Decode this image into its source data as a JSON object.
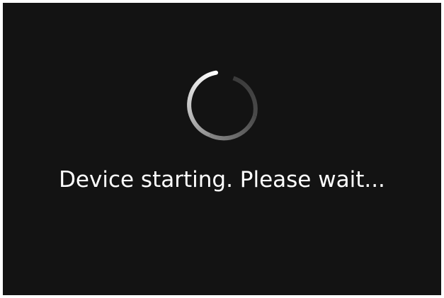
{
  "status": {
    "message": "Device starting. Please wait...",
    "spinner_icon": "loading-spinner-icon"
  },
  "colors": {
    "background": "#131313",
    "text": "#ffffff",
    "spinner": "#ffffff"
  }
}
